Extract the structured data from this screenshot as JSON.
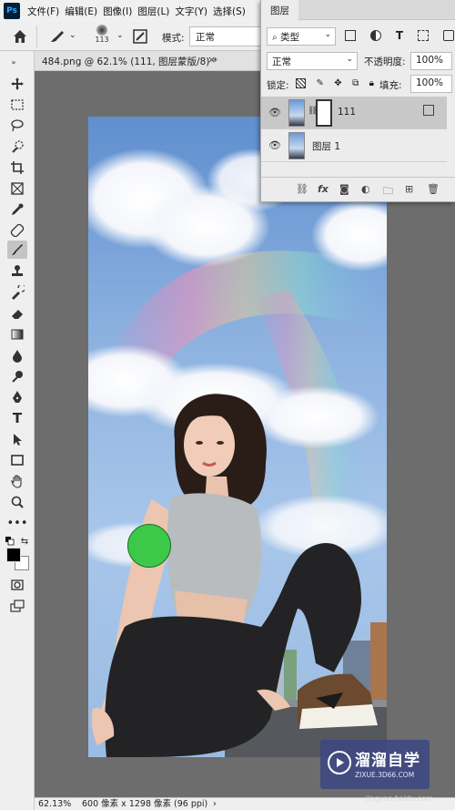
{
  "app": {
    "logo": "Ps"
  },
  "menubar": {
    "items": [
      "文件(F)",
      "编辑(E)",
      "图像(I)",
      "图层(L)",
      "文字(Y)",
      "选择(S)"
    ]
  },
  "options": {
    "brush_size": "113",
    "mode_label": "模式:",
    "mode_value": "正常"
  },
  "document": {
    "tab_title": "484.png @ 62.1% (111, 图层蒙版/8) *"
  },
  "layers": {
    "title": "图层",
    "filter": "类型",
    "blend_mode": "正常",
    "opacity_label": "不透明度:",
    "opacity_value": "100%",
    "lock_label": "锁定:",
    "fill_label": "填充:",
    "fill_value": "100%",
    "items": [
      {
        "name": "111",
        "selected": true
      },
      {
        "name": "图层 1",
        "selected": false
      }
    ]
  },
  "status": {
    "zoom": "62.13%",
    "dimensions": "600 像素 x 1298 像素 (96 ppi)"
  },
  "watermark": {
    "title": "溜溜自学",
    "subtitle": "ZIXUE.3D66.COM",
    "credit": "jingyan.baidu.com"
  },
  "colors": {
    "brush_cursor": "#3cc94a",
    "panel_bg": "#ececec",
    "canvas_bg": "#6d6d6d"
  },
  "icons": {
    "tools": [
      "move",
      "marquee",
      "lasso",
      "quick-select",
      "crop",
      "frame",
      "eyedropper",
      "healing",
      "brush",
      "stamp",
      "history-brush",
      "eraser",
      "gradient",
      "blur",
      "dodge",
      "pen",
      "type",
      "path-select",
      "rectangle",
      "hand",
      "zoom",
      "more"
    ]
  }
}
